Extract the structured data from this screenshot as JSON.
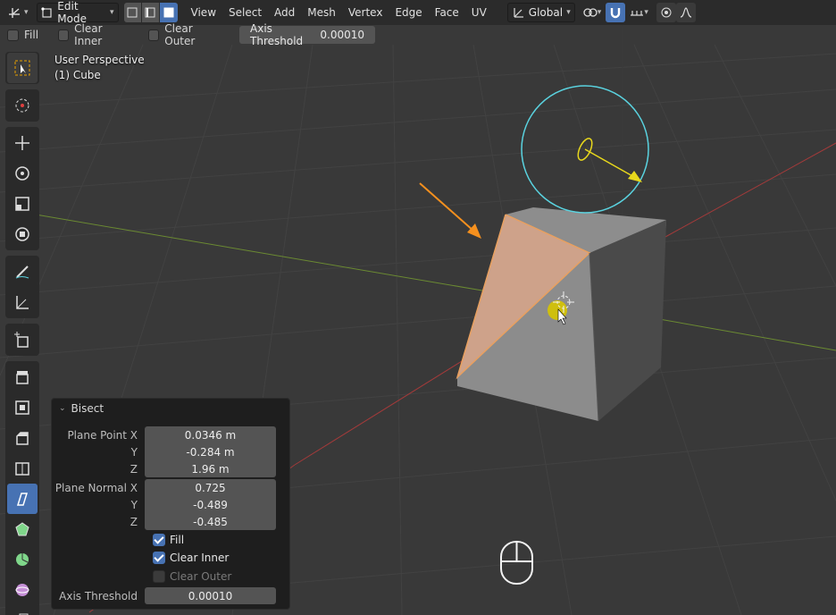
{
  "header": {
    "mode_label": "Edit Mode",
    "menus": [
      "View",
      "Select",
      "Add",
      "Mesh",
      "Vertex",
      "Edge",
      "Face",
      "UV"
    ],
    "transform_orientation": "Global"
  },
  "opbar": {
    "fill_label": "Fill",
    "clear_inner_label": "Clear Inner",
    "clear_outer_label": "Clear Outer",
    "axis_threshold_label": "Axis Threshold",
    "axis_threshold_value": "0.00010"
  },
  "viewport": {
    "perspective_label": "User Perspective",
    "object_label": "(1) Cube"
  },
  "bisect": {
    "title": "Bisect",
    "plane_point_x_label": "Plane Point X",
    "plane_point_x": "0.0346 m",
    "y_label": "Y",
    "plane_point_y": "-0.284 m",
    "z_label": "Z",
    "plane_point_z": "1.96 m",
    "plane_normal_x_label": "Plane Normal X",
    "plane_normal_x": "0.725",
    "plane_normal_y": "-0.489",
    "plane_normal_z": "-0.485",
    "fill_label": "Fill",
    "fill_checked": true,
    "clear_inner_label": "Clear Inner",
    "clear_inner_checked": true,
    "clear_outer_label": "Clear Outer",
    "clear_outer_checked": false,
    "axis_threshold_label": "Axis Threshold",
    "axis_threshold_value": "0.00010"
  },
  "colors": {
    "accent": "#4772b3",
    "annotation_arrow": "#f5901e",
    "gizmo_circle": "#5ad3e0",
    "gizmo_arrow": "#e8d81c",
    "cut_face": "#d9a68a",
    "x_axis": "#b34545",
    "y_axis": "#7a9a3a"
  },
  "toolbar_icons": [
    "select-box-icon",
    "cursor-icon",
    "move-icon",
    "rotate-icon",
    "scale-icon",
    "transform-icon",
    "annotate-icon",
    "measure-icon",
    "add-cube-icon",
    "extrude-icon",
    "inset-icon",
    "bevel-icon",
    "loop-cut-icon",
    "knife-icon",
    "poly-build-icon",
    "spin-icon",
    "smooth-icon",
    "shrink-fatten-icon"
  ]
}
